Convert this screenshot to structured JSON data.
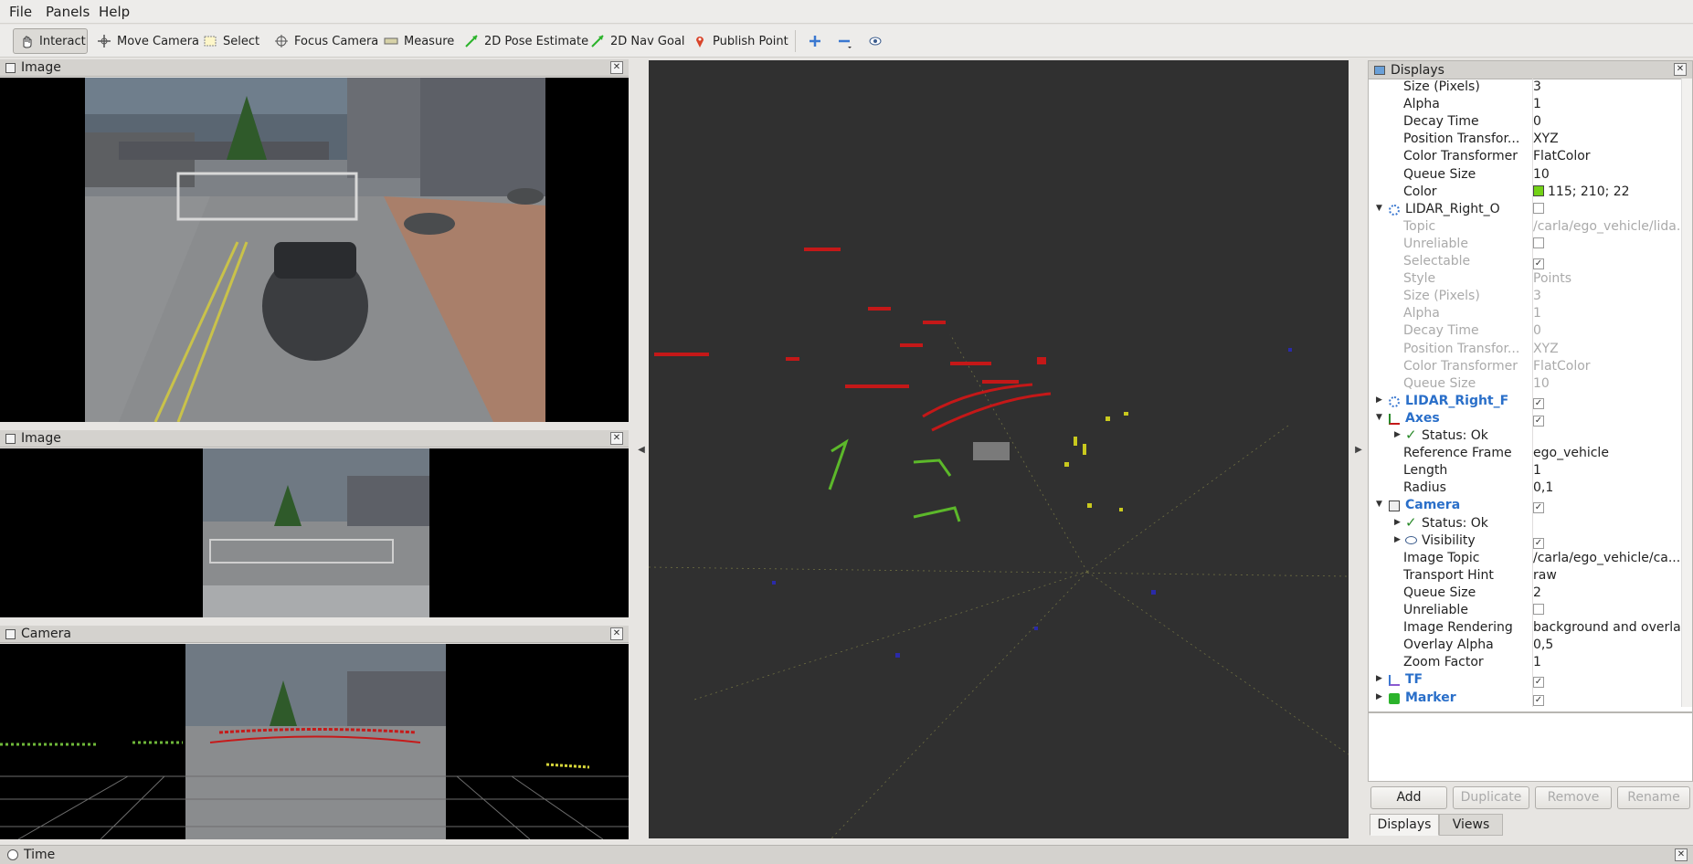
{
  "menu": {
    "file": "File",
    "panels": "Panels",
    "help": "Help"
  },
  "toolbar": {
    "interact": "Interact",
    "move_camera": "Move Camera",
    "select": "Select",
    "focus_camera": "Focus Camera",
    "measure": "Measure",
    "pose_estimate": "2D Pose Estimate",
    "nav_goal": "2D Nav Goal",
    "publish_point": "Publish Point"
  },
  "panels": {
    "image1_title": "Image",
    "image2_title": "Image",
    "camera_title": "Camera"
  },
  "displays": {
    "title": "Displays",
    "rows": [
      {
        "k": "Size (Pixels)",
        "v": "3"
      },
      {
        "k": "Alpha",
        "v": "1"
      },
      {
        "k": "Decay Time",
        "v": "0"
      },
      {
        "k": "Position Transfor...",
        "v": "XYZ"
      },
      {
        "k": "Color Transformer",
        "v": "FlatColor"
      },
      {
        "k": "Queue Size",
        "v": "10"
      },
      {
        "k": "Color",
        "v": "115; 210; 22"
      },
      {
        "k": "LIDAR_Right_O",
        "v": ""
      },
      {
        "k": "Topic",
        "v": "/carla/ego_vehicle/lida..."
      },
      {
        "k": "Unreliable",
        "v": ""
      },
      {
        "k": "Selectable",
        "v": ""
      },
      {
        "k": "Style",
        "v": "Points"
      },
      {
        "k": "Size (Pixels)",
        "v": "3"
      },
      {
        "k": "Alpha",
        "v": "1"
      },
      {
        "k": "Decay Time",
        "v": "0"
      },
      {
        "k": "Position Transfor...",
        "v": "XYZ"
      },
      {
        "k": "Color Transformer",
        "v": "FlatColor"
      },
      {
        "k": "Queue Size",
        "v": "10"
      },
      {
        "k": "LIDAR_Right_F",
        "v": ""
      },
      {
        "k": "Axes",
        "v": ""
      },
      {
        "k": "Status: Ok",
        "v": ""
      },
      {
        "k": "Reference Frame",
        "v": "ego_vehicle"
      },
      {
        "k": "Length",
        "v": "1"
      },
      {
        "k": "Radius",
        "v": "0,1"
      },
      {
        "k": "Camera",
        "v": ""
      },
      {
        "k": "Status: Ok",
        "v": ""
      },
      {
        "k": "Visibility",
        "v": ""
      },
      {
        "k": "Image Topic",
        "v": "/carla/ego_vehicle/ca..."
      },
      {
        "k": "Transport Hint",
        "v": "raw"
      },
      {
        "k": "Queue Size",
        "v": "2"
      },
      {
        "k": "Unreliable",
        "v": ""
      },
      {
        "k": "Image Rendering",
        "v": "background and overlay"
      },
      {
        "k": "Overlay Alpha",
        "v": "0,5"
      },
      {
        "k": "Zoom Factor",
        "v": "1"
      },
      {
        "k": "TF",
        "v": ""
      },
      {
        "k": "Marker",
        "v": ""
      }
    ],
    "color_swatch": "#73d216",
    "buttons": {
      "add": "Add",
      "duplicate": "Duplicate",
      "remove": "Remove",
      "rename": "Rename"
    },
    "tabs": {
      "displays": "Displays",
      "views": "Views"
    }
  },
  "time": {
    "title": "Time"
  }
}
